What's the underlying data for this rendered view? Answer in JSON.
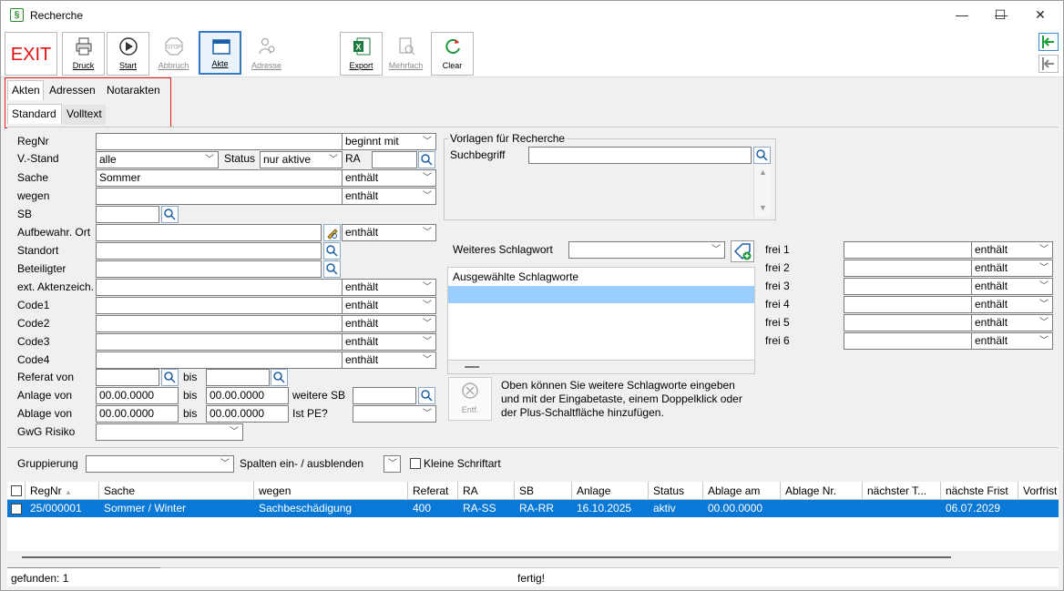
{
  "window": {
    "title": "Recherche",
    "icon_char": "§",
    "minimize": "—",
    "maximize": "☐",
    "close": "✕"
  },
  "toolbar": {
    "exit": "EXIT",
    "buttons": [
      {
        "label": "Druck",
        "icon": "printer-icon"
      },
      {
        "label": "Start",
        "icon": "play-icon"
      },
      {
        "label": "Abbruch",
        "icon": "stop-icon"
      },
      {
        "label": "Akte",
        "icon": "folder-icon"
      },
      {
        "label": "Adresse",
        "icon": "people-icon"
      },
      {
        "label": "Export",
        "icon": "excel-icon"
      },
      {
        "label": "Mehrfach",
        "icon": "document-search-icon"
      },
      {
        "label": "Clear",
        "icon": "refresh-icon"
      }
    ]
  },
  "tabs_main": [
    "Akten",
    "Adressen",
    "Notarakten"
  ],
  "tabs_sub": [
    "Standard",
    "Volltext"
  ],
  "form": {
    "regnr": {
      "label": "RegNr",
      "value": "",
      "op": "beginnt mit"
    },
    "vstand": {
      "label": "V.-Stand",
      "value": "alle"
    },
    "status": {
      "label": "Status",
      "value": "nur aktive"
    },
    "ra": {
      "label": "RA",
      "value": ""
    },
    "sache": {
      "label": "Sache",
      "value": "Sommer",
      "op": "enthält"
    },
    "wegen": {
      "label": "wegen",
      "value": "",
      "op": "enthält"
    },
    "sb": {
      "label": "SB",
      "value": ""
    },
    "aufbewahr": {
      "label": "Aufbewahr. Ort",
      "value": "",
      "op": "enthält"
    },
    "standort": {
      "label": "Standort",
      "value": ""
    },
    "beteiligter": {
      "label": "Beteiligter",
      "value": ""
    },
    "ext": {
      "label": "ext. Aktenzeich.",
      "value": "",
      "op": "enthält"
    },
    "code1": {
      "label": "Code1",
      "value": "",
      "op": "enthält"
    },
    "code2": {
      "label": "Code2",
      "value": "",
      "op": "enthält"
    },
    "code3": {
      "label": "Code3",
      "value": "",
      "op": "enthält"
    },
    "code4": {
      "label": "Code4",
      "value": "",
      "op": "enthält"
    },
    "referat_von": {
      "label": "Referat von",
      "bis": "bis"
    },
    "anlage_von": {
      "label": "Anlage von",
      "from": "00.00.0000",
      "bis": "bis",
      "to": "00.00.0000",
      "weitere_sb": "weitere SB"
    },
    "ablage_von": {
      "label": "Ablage von",
      "from": "00.00.0000",
      "bis": "bis",
      "to": "00.00.0000",
      "ist_pe": "Ist PE?"
    },
    "gwg": {
      "label": "GwG Risiko",
      "value": ""
    }
  },
  "vorlagen": {
    "legend": "Vorlagen für Recherche",
    "suchbegriff": "Suchbegriff",
    "value": ""
  },
  "schlagwort": {
    "label": "Weiteres Schlagwort",
    "list_header": "Ausgewählte Schlagworte",
    "entf": "Entf.",
    "hint": [
      "Oben können Sie weitere Schlagworte eingeben",
      "und mit der Eingabetaste, einem Doppelklick oder",
      "der Plus-Schaltfläche hinzufügen."
    ]
  },
  "frei": [
    {
      "label": "frei 1",
      "op": "enthält"
    },
    {
      "label": "frei 2",
      "op": "enthält"
    },
    {
      "label": "frei 3",
      "op": "enthält"
    },
    {
      "label": "frei 4",
      "op": "enthält"
    },
    {
      "label": "frei 5",
      "op": "enthält"
    },
    {
      "label": "frei 6",
      "op": "enthält"
    }
  ],
  "grouping": {
    "label": "Gruppierung",
    "value": "",
    "spalten": "Spalten ein- / ausblenden",
    "kleine": "Kleine Schriftart"
  },
  "grid": {
    "columns": [
      "RegNr",
      "Sache",
      "wegen",
      "Referat",
      "RA",
      "SB",
      "Anlage",
      "Status",
      "Ablage am",
      "Ablage Nr.",
      "nächster T...",
      "nächste Frist",
      "Vorfrist"
    ],
    "sort_indicator": "▲",
    "rows": [
      [
        "25/000001",
        "Sommer / Winter",
        "Sachbeschädigung",
        "400",
        "RA-SS",
        "RA-RR",
        "16.10.2025",
        "aktiv",
        "00.00.0000",
        "",
        "",
        "06.07.2029",
        ""
      ]
    ]
  },
  "statusbar": {
    "left": "gefunden: 1",
    "center": "fertig!"
  }
}
